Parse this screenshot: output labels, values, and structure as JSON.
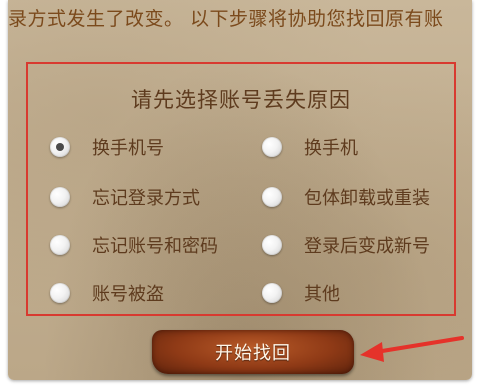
{
  "notice": "录方式发生了改变。 以下步骤将协助您找回原有账",
  "box": {
    "title": "请先选择账号丢失原因"
  },
  "options": [
    {
      "label": "换手机号",
      "checked": true
    },
    {
      "label": "换手机",
      "checked": false
    },
    {
      "label": "忘记登录方式",
      "checked": false
    },
    {
      "label": "包体卸载或重装",
      "checked": false
    },
    {
      "label": "忘记账号和密码",
      "checked": false
    },
    {
      "label": "登录后变成新号",
      "checked": false
    },
    {
      "label": "账号被盗",
      "checked": false
    },
    {
      "label": "其他",
      "checked": false
    }
  ],
  "start_button": {
    "label": "开始找回"
  },
  "colors": {
    "text_brown": "#5e3b1e",
    "notice_brown": "#7b4a1c",
    "highlight_red": "#d83a30",
    "button_brown": "#8f3a16"
  }
}
